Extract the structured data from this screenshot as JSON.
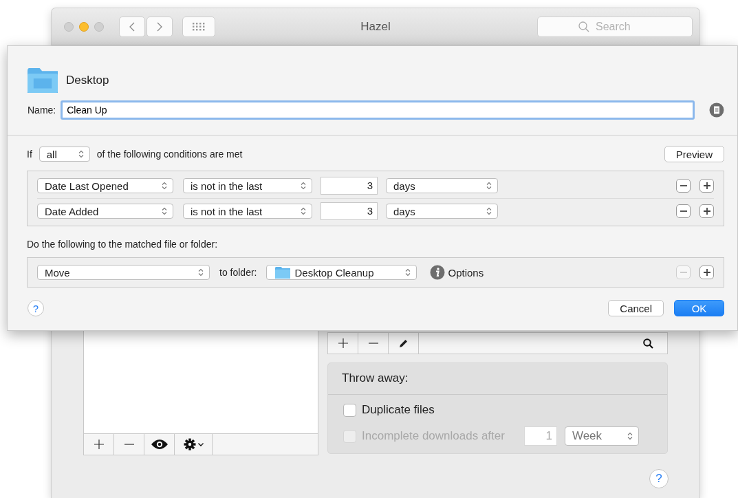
{
  "window": {
    "title": "Hazel",
    "search": {
      "placeholder": "Search"
    }
  },
  "sheet": {
    "folder": "Desktop",
    "name_label": "Name:",
    "name_value": "Clean Up",
    "conditions_header": {
      "prefix": "If",
      "match": "all",
      "suffix": "of the following conditions are met"
    },
    "preview_button": "Preview",
    "conditions": [
      {
        "attribute": "Date Last Opened",
        "operator": "is not in the last",
        "amount": "3",
        "unit": "days",
        "remove_disabled": false
      },
      {
        "attribute": "Date Added",
        "operator": "is not in the last",
        "amount": "3",
        "unit": "days",
        "remove_disabled": false
      }
    ],
    "actions_header": "Do the following to the matched file or folder:",
    "actions": [
      {
        "action": "Move",
        "target_label": "to folder:",
        "folder": "Desktop Cleanup",
        "options": "Options",
        "remove_disabled": true
      }
    ],
    "help": "?",
    "buttons": [
      {
        "label": "Cancel",
        "default": false
      },
      {
        "label": "OK",
        "default": true
      }
    ]
  },
  "background": {
    "throw_away": {
      "title": "Throw away:",
      "options": [
        {
          "label": "Duplicate files",
          "checked": false,
          "disabled": false
        },
        {
          "label": "Incomplete downloads after",
          "checked": false,
          "disabled": true,
          "amount": "1",
          "unit": "Week"
        }
      ]
    },
    "help": "?"
  }
}
